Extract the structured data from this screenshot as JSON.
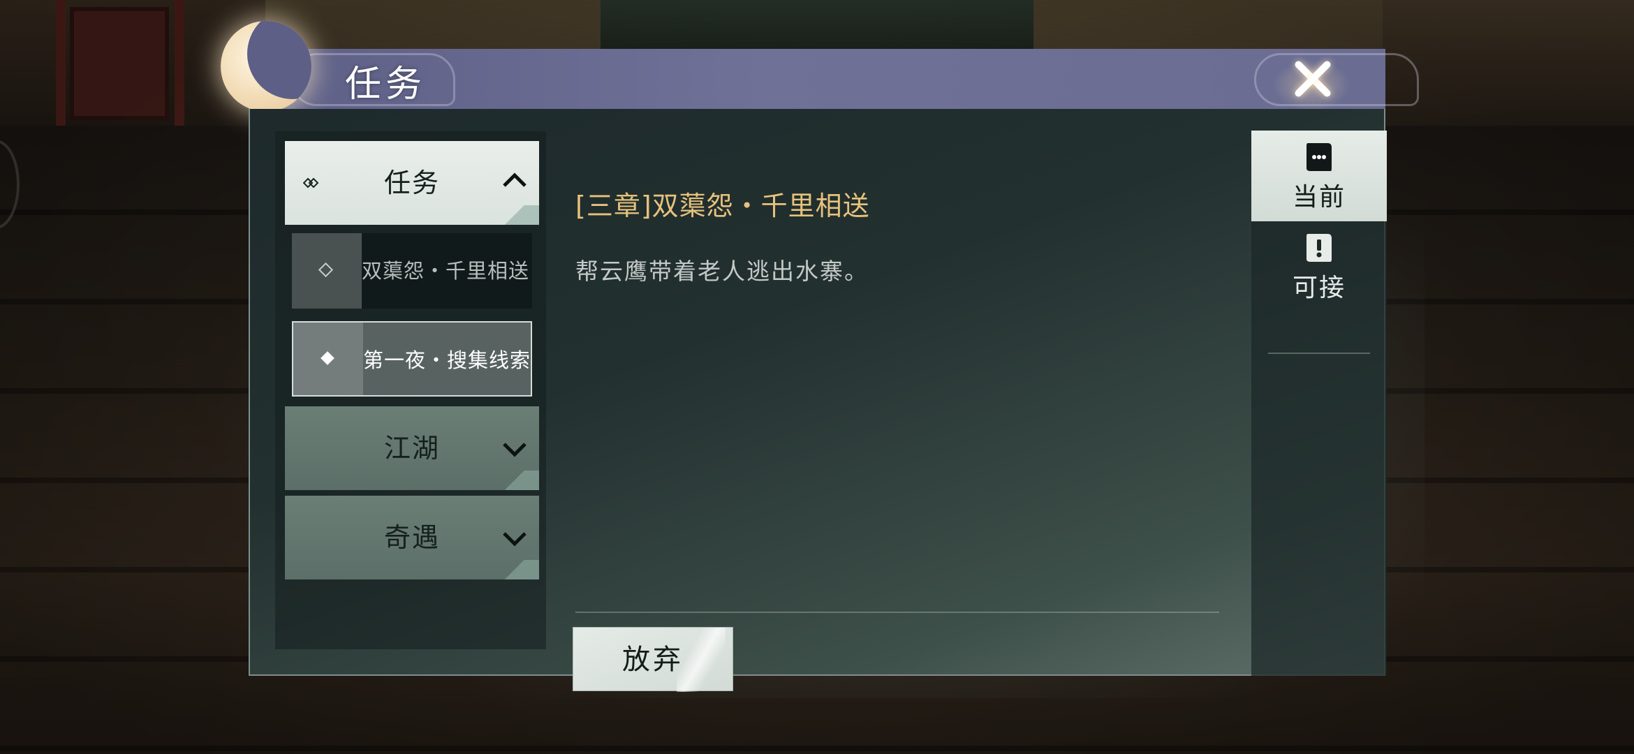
{
  "dialog": {
    "title": "任务",
    "close_icon": "close-icon"
  },
  "categories": [
    {
      "label": "任务",
      "state": "expanded",
      "icon": "diamond-icon",
      "chevron": "chevron-up-icon"
    },
    {
      "label": "江湖",
      "state": "collapsed",
      "chevron": "chevron-down-icon"
    },
    {
      "label": "奇遇",
      "state": "collapsed",
      "chevron": "chevron-down-icon"
    }
  ],
  "quests": [
    {
      "label": "双蕖怨・千里相送",
      "active": false
    },
    {
      "label": "第一夜・搜集线索",
      "active": true
    }
  ],
  "detail": {
    "title": "[三章]双蕖怨・千里相送",
    "description": "帮云鹰带着老人逃出水寨。",
    "abandon_label": "放弃"
  },
  "tabs": [
    {
      "label": "当前",
      "icon": "scroll-dots-icon",
      "active": true
    },
    {
      "label": "可接",
      "icon": "scroll-exclaim-icon",
      "active": false
    }
  ],
  "colors": {
    "header": "#6a6c92",
    "quest_title": "#e7c27c",
    "panel_light": "#e6ece8",
    "panel_green": "#5f7269"
  }
}
